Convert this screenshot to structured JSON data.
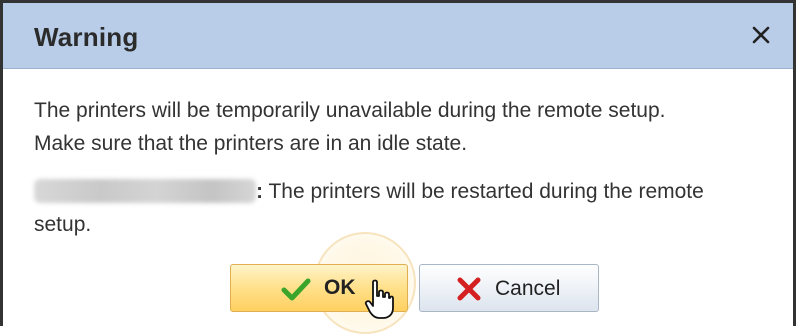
{
  "dialog": {
    "title": "Warning",
    "close_symbol": "close-icon",
    "message_line1": "The printers will be temporarily unavailable during the remote setup.",
    "message_line2": "Make sure that the printers are in an idle state.",
    "device_name": "[blurred]",
    "separator": ":",
    "message_line3": " The printers will be restarted during the remote",
    "message_line4": "setup."
  },
  "buttons": {
    "ok_label": "OK",
    "ok_icon": "checkmark-icon",
    "cancel_label": "Cancel",
    "cancel_icon": "x-icon"
  },
  "colors": {
    "titlebar": "#b9cde8",
    "ok_button": "#ffe08a",
    "checkmark": "#3aa52a",
    "cancel_x": "#d42020"
  }
}
